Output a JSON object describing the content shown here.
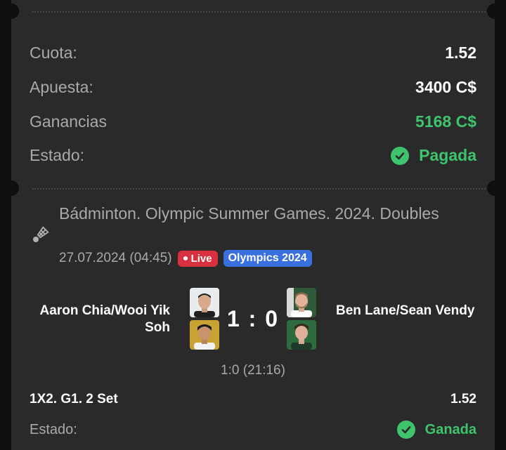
{
  "summary": {
    "odds_label": "Cuota:",
    "odds_value": "1.52",
    "stake_label": "Apuesta:",
    "stake_value": "3400 C$",
    "winnings_label": "Ganancias",
    "winnings_value": "5168 C$",
    "status_label": "Estado:",
    "status_value": "Pagada"
  },
  "event": {
    "title": "Bádminton. Olympic Summer Games. 2024. Doubles",
    "datetime": "27.07.2024 (04:45)",
    "live_badge": "Live",
    "tournament_badge": "Olympics 2024",
    "team_home": "Aaron Chia/Wooi Yik Soh",
    "team_away": "Ben Lane/Sean Vendy",
    "score": "1 : 0",
    "subscore": "1:0 (21:16)"
  },
  "selection": {
    "market": "1X2. G1. 2 Set",
    "odds": "1.52",
    "status_label": "Estado:",
    "status_value": "Ganada"
  },
  "colors": {
    "background": "#0f0f0f",
    "card": "#2a2a2a",
    "success": "#3ec46d",
    "live": "#d8303f",
    "tournament": "#3a6fe0"
  },
  "icons": {
    "sport": "shuttlecock-icon",
    "status": "check-circle-icon"
  }
}
